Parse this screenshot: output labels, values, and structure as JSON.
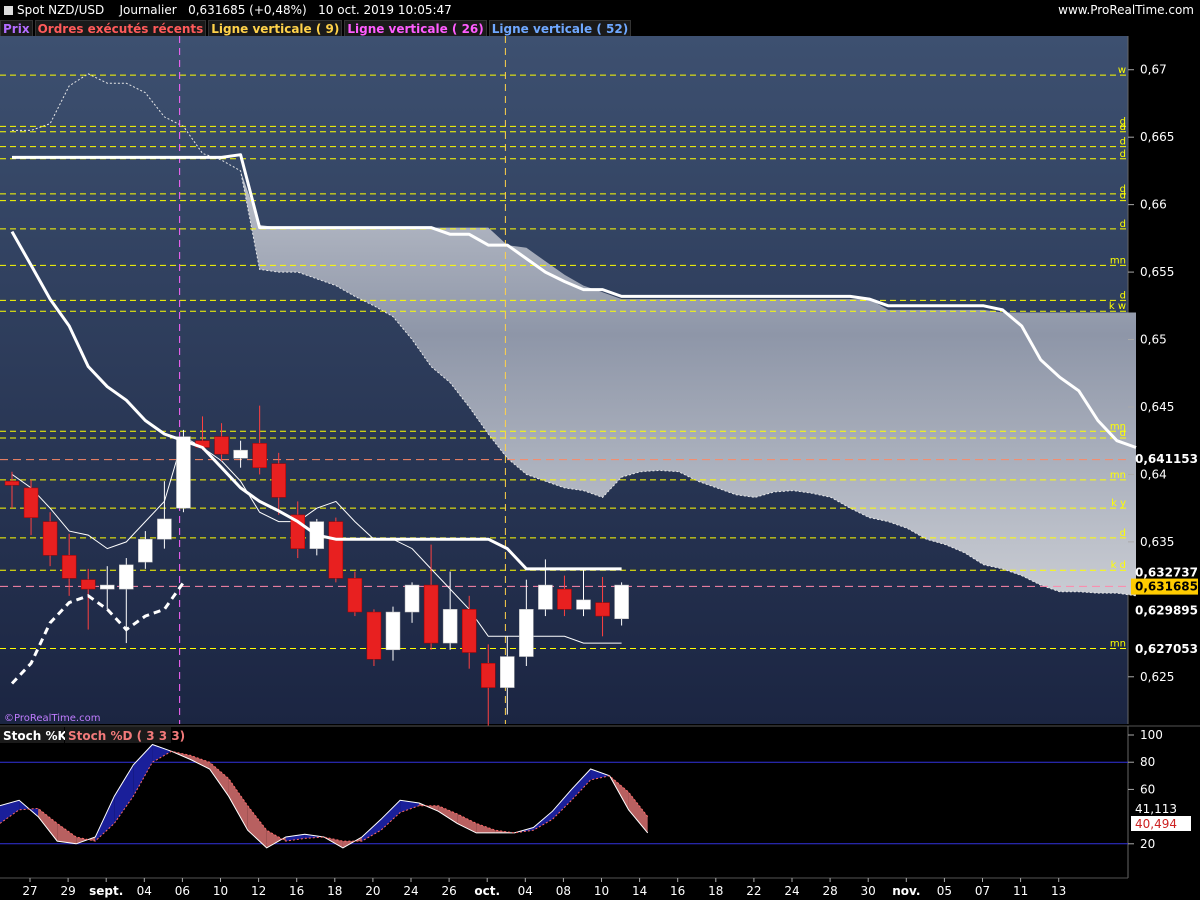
{
  "header": {
    "instrument": "Spot NZD/USD",
    "period": "Journalier",
    "quote": "0,631685 (+0,48%)",
    "datetime": "10 oct. 2019 10:05:47",
    "site": "www.ProRealTime.com"
  },
  "legend": [
    {
      "label": "Prix",
      "color": "#b36cff"
    },
    {
      "label": "Ordres exécutés récents",
      "color": "#ff5a5a"
    },
    {
      "label": "Ligne verticale ( 9)",
      "color": "#ffd24a"
    },
    {
      "label": "Ligne verticale ( 26)",
      "color": "#ff5cff"
    },
    {
      "label": "Ligne verticale ( 52)",
      "color": "#6fa8ff"
    }
  ],
  "watermark": "©ProRealTime.com",
  "colors": {
    "up": "#ffffff",
    "down": "#e82020",
    "level": "#ffff00",
    "panel_bg_top": "#3b4d6d",
    "panel_bg_bottom": "#1a2440"
  },
  "chart_data": [
    {
      "type": "candlestick",
      "title": "Spot NZD/USD",
      "x_labels": [
        "27",
        "29",
        "sept.",
        "04",
        "06",
        "10",
        "12",
        "16",
        "18",
        "20",
        "24",
        "26",
        "oct.",
        "04",
        "08",
        "10",
        "14",
        "16",
        "18",
        "22",
        "24",
        "28",
        "30",
        "nov.",
        "05",
        "07",
        "11",
        "13"
      ],
      "y_ticks": [
        "0,67",
        "0,665",
        "0,66",
        "0,655",
        "0,65",
        "0,645",
        "0,64",
        "0,635",
        "0,625"
      ],
      "ylim": [
        0.6215,
        0.6725
      ],
      "candles": [
        {
          "o": 0.6395,
          "h": 0.6402,
          "l": 0.6375,
          "c": 0.6392
        },
        {
          "o": 0.639,
          "h": 0.6396,
          "l": 0.6355,
          "c": 0.6368
        },
        {
          "o": 0.6365,
          "h": 0.6372,
          "l": 0.6332,
          "c": 0.634
        },
        {
          "o": 0.634,
          "h": 0.6356,
          "l": 0.631,
          "c": 0.6323
        },
        {
          "o": 0.6322,
          "h": 0.633,
          "l": 0.6285,
          "c": 0.6315
        },
        {
          "o": 0.6315,
          "h": 0.6332,
          "l": 0.63,
          "c": 0.6318
        },
        {
          "o": 0.6315,
          "h": 0.6338,
          "l": 0.6275,
          "c": 0.6333
        },
        {
          "o": 0.6335,
          "h": 0.6358,
          "l": 0.633,
          "c": 0.6352
        },
        {
          "o": 0.6352,
          "h": 0.6395,
          "l": 0.6345,
          "c": 0.6367
        },
        {
          "o": 0.6375,
          "h": 0.6433,
          "l": 0.6372,
          "c": 0.6428
        },
        {
          "o": 0.6425,
          "h": 0.6443,
          "l": 0.6418,
          "c": 0.642
        },
        {
          "o": 0.6428,
          "h": 0.6438,
          "l": 0.641,
          "c": 0.6415
        },
        {
          "o": 0.6412,
          "h": 0.6425,
          "l": 0.6405,
          "c": 0.6418
        },
        {
          "o": 0.6423,
          "h": 0.6451,
          "l": 0.64,
          "c": 0.6405
        },
        {
          "o": 0.6408,
          "h": 0.6416,
          "l": 0.637,
          "c": 0.6383
        },
        {
          "o": 0.637,
          "h": 0.638,
          "l": 0.6338,
          "c": 0.6345
        },
        {
          "o": 0.6345,
          "h": 0.6367,
          "l": 0.634,
          "c": 0.6365
        },
        {
          "o": 0.6365,
          "h": 0.6368,
          "l": 0.632,
          "c": 0.6323
        },
        {
          "o": 0.6323,
          "h": 0.6328,
          "l": 0.6295,
          "c": 0.6298
        },
        {
          "o": 0.6298,
          "h": 0.63,
          "l": 0.6258,
          "c": 0.6263
        },
        {
          "o": 0.627,
          "h": 0.6302,
          "l": 0.6262,
          "c": 0.6298
        },
        {
          "o": 0.6298,
          "h": 0.632,
          "l": 0.629,
          "c": 0.6318
        },
        {
          "o": 0.6318,
          "h": 0.6348,
          "l": 0.627,
          "c": 0.6275
        },
        {
          "o": 0.6275,
          "h": 0.6328,
          "l": 0.627,
          "c": 0.63
        },
        {
          "o": 0.63,
          "h": 0.631,
          "l": 0.6256,
          "c": 0.6268
        },
        {
          "o": 0.626,
          "h": 0.6274,
          "l": 0.6208,
          "c": 0.6242
        },
        {
          "o": 0.6242,
          "h": 0.628,
          "l": 0.6222,
          "c": 0.6265
        },
        {
          "o": 0.6265,
          "h": 0.6322,
          "l": 0.6258,
          "c": 0.63
        },
        {
          "o": 0.63,
          "h": 0.6337,
          "l": 0.6295,
          "c": 0.6318
        },
        {
          "o": 0.6315,
          "h": 0.6325,
          "l": 0.6295,
          "c": 0.63
        },
        {
          "o": 0.63,
          "h": 0.633,
          "l": 0.6295,
          "c": 0.6307
        },
        {
          "o": 0.6305,
          "h": 0.6324,
          "l": 0.628,
          "c": 0.6295
        },
        {
          "o": 0.6293,
          "h": 0.632,
          "l": 0.6288,
          "c": 0.6318
        }
      ],
      "cloud_upper": [
        0.6655,
        0.6655,
        0.666,
        0.6688,
        0.6697,
        0.669,
        0.669,
        0.6683,
        0.6665,
        0.6658,
        0.6638,
        0.6633,
        0.6625,
        0.6585,
        0.6583,
        0.6583,
        0.6583,
        0.6583,
        0.6583,
        0.6583,
        0.6583,
        0.6583,
        0.6583,
        0.6583,
        0.6583,
        0.6583,
        0.657,
        0.6568,
        0.6558,
        0.6548,
        0.654,
        0.6535,
        0.653,
        0.653,
        0.653,
        0.653,
        0.653,
        0.653,
        0.653,
        0.653,
        0.653,
        0.653,
        0.653,
        0.653,
        0.653,
        0.653,
        0.6522,
        0.6522,
        0.6522,
        0.6522,
        0.6522,
        0.6522,
        0.652,
        0.652,
        0.652,
        0.652,
        0.652,
        0.652,
        0.652,
        0.652
      ],
      "cloud_lower": [
        0.6655,
        0.6655,
        0.666,
        0.6688,
        0.6697,
        0.669,
        0.669,
        0.6683,
        0.6665,
        0.6658,
        0.6638,
        0.6633,
        0.6625,
        0.6552,
        0.655,
        0.655,
        0.6545,
        0.654,
        0.6532,
        0.6525,
        0.6517,
        0.65,
        0.648,
        0.6468,
        0.645,
        0.643,
        0.6412,
        0.64,
        0.6395,
        0.639,
        0.6388,
        0.6383,
        0.6398,
        0.6402,
        0.6403,
        0.6402,
        0.6395,
        0.639,
        0.6385,
        0.6383,
        0.6387,
        0.6388,
        0.6386,
        0.6383,
        0.6375,
        0.6368,
        0.6365,
        0.636,
        0.6352,
        0.6348,
        0.6342,
        0.6333,
        0.633,
        0.6325,
        0.6318,
        0.6313,
        0.6313,
        0.6312,
        0.6312,
        0.631
      ],
      "line_thick_white": [
        0.658,
        0.6555,
        0.653,
        0.651,
        0.648,
        0.6465,
        0.6455,
        0.644,
        0.643,
        0.6425,
        0.642,
        0.6405,
        0.639,
        0.638,
        0.6373,
        0.6365,
        0.6355,
        0.6352,
        0.6352,
        0.6352,
        0.6352,
        0.6352,
        0.6352,
        0.6352,
        0.6352,
        0.6352,
        0.6345,
        0.633,
        0.633,
        0.633,
        0.633,
        0.633,
        0.633
      ],
      "kijun_line": [
        0.6635,
        0.6635,
        0.6635,
        0.6635,
        0.6635,
        0.6635,
        0.6635,
        0.6635,
        0.6635,
        0.6635,
        0.6635,
        0.6635,
        0.6637,
        0.6583,
        0.6583,
        0.6583,
        0.6583,
        0.6583,
        0.6583,
        0.6583,
        0.6583,
        0.6583,
        0.6583,
        0.6578,
        0.6578,
        0.657,
        0.657,
        0.656,
        0.655,
        0.6543,
        0.6537,
        0.6537,
        0.6532,
        0.6532,
        0.6532,
        0.6532,
        0.6532,
        0.6532,
        0.6532,
        0.6532,
        0.6532,
        0.6532,
        0.6532,
        0.6532,
        0.6532,
        0.653,
        0.6525,
        0.6525,
        0.6525,
        0.6525,
        0.6525,
        0.6525,
        0.6522,
        0.651,
        0.6485,
        0.6472,
        0.6462,
        0.644,
        0.6425,
        0.642
      ],
      "tenkan_thin": [
        0.64,
        0.639,
        0.6375,
        0.6358,
        0.6355,
        0.6345,
        0.635,
        0.6365,
        0.638,
        0.6428,
        0.642,
        0.641,
        0.6395,
        0.6372,
        0.6365,
        0.6365,
        0.6375,
        0.638,
        0.6365,
        0.6352,
        0.6352,
        0.6345,
        0.633,
        0.6315,
        0.63,
        0.628,
        0.628,
        0.628,
        0.628,
        0.628,
        0.6275,
        0.6275,
        0.6275
      ],
      "chikou_dashed": [
        0.6245,
        0.626,
        0.629,
        0.6305,
        0.631,
        0.63,
        0.6285,
        0.6295,
        0.63,
        0.632
      ],
      "levels": [
        {
          "label": "w",
          "value": 0.6696
        },
        {
          "label": "d",
          "value": 0.6658
        },
        {
          "label": "d",
          "value": 0.6654
        },
        {
          "label": "d",
          "value": 0.6643
        },
        {
          "label": "d",
          "value": 0.6634
        },
        {
          "label": "d",
          "value": 0.6608
        },
        {
          "label": "d",
          "value": 0.6603
        },
        {
          "label": "d",
          "value": 0.6582
        },
        {
          "label": "mn",
          "value": 0.6555
        },
        {
          "label": "d",
          "value": 0.6529
        },
        {
          "label": "k w",
          "value": 0.6521
        },
        {
          "label": "mn",
          "value": 0.6432
        },
        {
          "label": "d",
          "value": 0.6427
        },
        {
          "label": "mn",
          "value": 0.6396
        },
        {
          "label": "k y",
          "value": 0.6375
        },
        {
          "label": "d",
          "value": 0.6353
        },
        {
          "label": "k d",
          "value": 0.6329
        },
        {
          "label": "mn",
          "value": 0.6271
        }
      ],
      "hline_orange": 0.6411,
      "hline_pink": 0.6317,
      "vlines": [
        {
          "at": 8.8,
          "color": "#ff66ff"
        },
        {
          "at": 25.9,
          "color": "#ffd24a"
        }
      ],
      "price_labels": [
        {
          "value": 0.641153,
          "text": "0,641153",
          "style": "plain"
        },
        {
          "value": 0.632737,
          "text": "0,632737",
          "style": "plain"
        },
        {
          "value": 0.631685,
          "text": "0,631685",
          "style": "current"
        },
        {
          "value": 0.629895,
          "text": "0,629895",
          "style": "plain"
        },
        {
          "value": 0.627053,
          "text": "0,627053",
          "style": "plain"
        }
      ]
    },
    {
      "type": "line",
      "title": "Stoch %K",
      "series": [
        {
          "name": "Stoch %K",
          "values": [
            48,
            52,
            40,
            22,
            20,
            25,
            55,
            78,
            93,
            88,
            82,
            75,
            55,
            30,
            17,
            25,
            27,
            25,
            17,
            25,
            38,
            52,
            50,
            44,
            35,
            28,
            28,
            28,
            32,
            44,
            60,
            75,
            70,
            45,
            28
          ]
        },
        {
          "name": "Stoch %D ( 3 3 3)",
          "values": [
            35,
            45,
            46,
            35,
            25,
            22,
            35,
            55,
            80,
            88,
            85,
            80,
            68,
            48,
            30,
            22,
            24,
            25,
            22,
            22,
            30,
            43,
            48,
            48,
            42,
            35,
            30,
            28,
            30,
            38,
            52,
            67,
            70,
            58,
            40
          ]
        }
      ],
      "ylim": [
        0,
        100
      ],
      "y_ticks": [
        "100",
        "80",
        "60",
        "20"
      ],
      "hlines": [
        80,
        20
      ],
      "value_labels": [
        {
          "text": "41,113",
          "style": "k"
        },
        {
          "text": "40,494",
          "style": "d"
        }
      ]
    }
  ]
}
